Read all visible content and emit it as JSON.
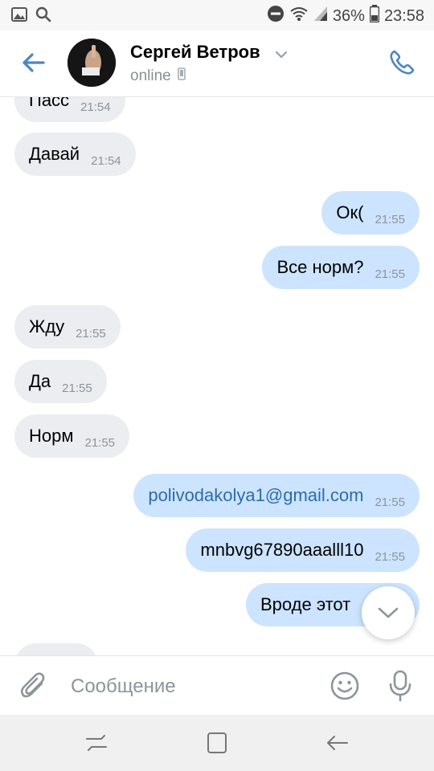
{
  "status_bar": {
    "battery": "36%",
    "time": "23:58",
    "icons": [
      "gallery-icon",
      "search-icon",
      "do-not-disturb-icon",
      "wifi-icon",
      "signal-icon",
      "battery-icon"
    ]
  },
  "header": {
    "name": "Сергей Ветров",
    "status": "online",
    "icons": [
      "back-arrow-icon",
      "chevron-down-icon",
      "mobile-device-icon",
      "phone-icon"
    ]
  },
  "messages": [
    {
      "dir": "in",
      "text": "Пасс",
      "time": "21:54"
    },
    {
      "dir": "in",
      "text": "Давай",
      "time": "21:54"
    },
    {
      "dir": "out",
      "text": "Ок(",
      "time": "21:55"
    },
    {
      "dir": "out",
      "text": "Все норм?",
      "time": "21:55"
    },
    {
      "dir": "in",
      "text": "Жду",
      "time": "21:55"
    },
    {
      "dir": "in",
      "text": "Да",
      "time": "21:55"
    },
    {
      "dir": "in",
      "text": "Норм",
      "time": "21:55"
    },
    {
      "dir": "out",
      "text": "polivodakolya1@gmail.com",
      "time": "21:55",
      "link": true
    },
    {
      "dir": "out",
      "text": "mnbvg67890aaalll10",
      "time": "21:55"
    },
    {
      "dir": "out",
      "text": "Вроде этот",
      "time": ""
    }
  ],
  "composer": {
    "placeholder": "Сообщение",
    "icons": [
      "attach-icon",
      "emoji-icon",
      "mic-icon"
    ]
  },
  "colors": {
    "accent": "#4a86c5",
    "incoming_bubble": "#ebedf0",
    "outgoing_bubble": "#cce4ff",
    "link": "#2b6cb0"
  }
}
